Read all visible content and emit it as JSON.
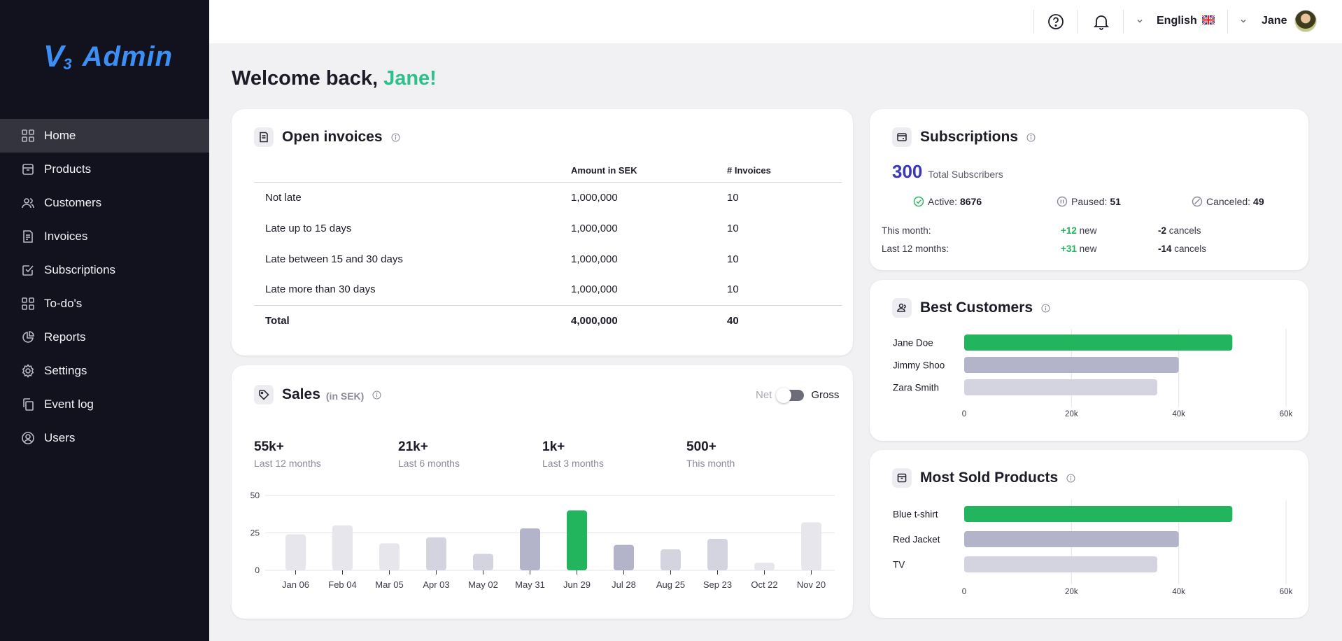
{
  "sidebar": {
    "logo": {
      "v": "V",
      "three": "3",
      "text": "Admin"
    },
    "items": [
      {
        "label": "Home",
        "icon": "grid-icon",
        "active": true
      },
      {
        "label": "Products",
        "icon": "box-icon"
      },
      {
        "label": "Customers",
        "icon": "users-icon"
      },
      {
        "label": "Invoices",
        "icon": "document-icon"
      },
      {
        "label": "Subscriptions",
        "icon": "checkbox-icon"
      },
      {
        "label": "To-do's",
        "icon": "grid-icon"
      },
      {
        "label": "Reports",
        "icon": "pie-chart-icon"
      },
      {
        "label": "Settings",
        "icon": "gear-icon"
      },
      {
        "label": "Event log",
        "icon": "copy-icon"
      },
      {
        "label": "Users",
        "icon": "user-circle-icon"
      }
    ]
  },
  "topbar": {
    "language": "English",
    "user": "Jane"
  },
  "welcome": {
    "prefix": "Welcome back,",
    "name": "Jane!"
  },
  "invoices": {
    "title": "Open invoices",
    "headers": [
      "",
      "Amount in SEK",
      "# Invoices"
    ],
    "rows": [
      {
        "label": "Not late",
        "amount": "1,000,000",
        "count": "10"
      },
      {
        "label": "Late up to 15 days",
        "amount": "1,000,000",
        "count": "10"
      },
      {
        "label": "Late between 15 and 30 days",
        "amount": "1,000,000",
        "count": "10"
      },
      {
        "label": "Late more than 30 days",
        "amount": "1,000,000",
        "count": "10"
      }
    ],
    "total": {
      "label": "Total",
      "amount": "4,000,000",
      "count": "40"
    }
  },
  "sales": {
    "title": "Sales",
    "unit": "(in SEK)",
    "toggle": {
      "left": "Net",
      "right": "Gross"
    },
    "stats": [
      {
        "value": "55k+",
        "label": "Last 12 months"
      },
      {
        "value": "21k+",
        "label": "Last 6 months"
      },
      {
        "value": "1k+",
        "label": "Last 3 months"
      },
      {
        "value": "500+",
        "label": "This month"
      }
    ]
  },
  "subscriptions": {
    "title": "Subscriptions",
    "total": "300",
    "total_label": "Total Subscribers",
    "active_label": "Active:",
    "active": "8676",
    "paused_label": "Paused:",
    "paused": "51",
    "canceled_label": "Canceled:",
    "canceled": "49",
    "month_label": "This month:",
    "month_new": "+12",
    "month_cancels": "-2",
    "year_label": "Last 12 months:",
    "year_new": "+31",
    "year_cancels": "-14",
    "new_word": "new",
    "cancels_word": "cancels"
  },
  "best_customers": {
    "title": "Best Customers"
  },
  "most_sold": {
    "title": "Most Sold Products"
  },
  "colors": {
    "accent_green": "#22b55e",
    "mid_gray": "#b3b3c9",
    "light_gray": "#d4d4e0",
    "pale_gray": "#e6e6ec",
    "sidebar_bg": "#12121f"
  },
  "chart_data": [
    {
      "type": "bar",
      "categories": [
        "Jan 06",
        "Feb 04",
        "Mar 05",
        "Apr 03",
        "May 02",
        "May 31",
        "Jun 29",
        "Jul 28",
        "Aug 25",
        "Sep 23",
        "Oct 22",
        "Nov 20"
      ],
      "values": [
        24,
        30,
        18,
        22,
        11,
        28,
        40,
        17,
        14,
        21,
        5,
        32
      ],
      "highlight_index": 6,
      "yticks": [
        0,
        25,
        50
      ],
      "ylim": [
        0,
        50
      ]
    },
    {
      "type": "bar",
      "orientation": "horizontal",
      "categories": [
        "Jane Doe",
        "Jimmy Shoo",
        "Zara Smith"
      ],
      "values": [
        50000,
        40000,
        36000
      ],
      "xticks": [
        "0",
        "20k",
        "40k",
        "60k"
      ],
      "xlim": [
        0,
        60000
      ]
    },
    {
      "type": "bar",
      "orientation": "horizontal",
      "categories": [
        "Blue t-shirt",
        "Red Jacket",
        "TV"
      ],
      "values": [
        50000,
        40000,
        36000
      ],
      "xticks": [
        "0",
        "20k",
        "40k",
        "60k"
      ],
      "xlim": [
        0,
        60000
      ]
    }
  ]
}
